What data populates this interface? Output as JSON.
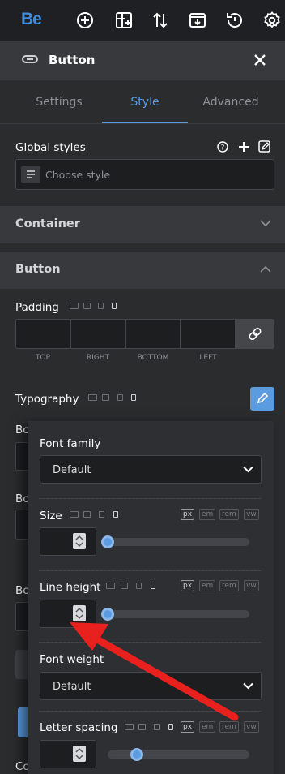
{
  "toolbar": {
    "logo": "Be",
    "icons": [
      "add-icon",
      "layout-add-icon",
      "sort-arrows-icon",
      "import-icon",
      "history-icon",
      "settings-gear-icon"
    ]
  },
  "panel": {
    "title": "Button",
    "icon": "link-icon"
  },
  "tabs": [
    {
      "label": "Settings",
      "active": false
    },
    {
      "label": "Style",
      "active": true
    },
    {
      "label": "Advanced",
      "active": false
    }
  ],
  "global_styles": {
    "label": "Global styles",
    "placeholder": "Choose style"
  },
  "sections": {
    "container": "Container",
    "button": "Button"
  },
  "padding": {
    "label": "Padding",
    "sides": [
      "TOP",
      "RIGHT",
      "BOTTOM",
      "LEFT"
    ]
  },
  "typography": {
    "label": "Typography"
  },
  "hidden_labels": {
    "b1": "Bo",
    "b2": "Bo",
    "b3": "Bo",
    "c": "Co"
  },
  "popover": {
    "font_family": {
      "label": "Font family",
      "value": "Default"
    },
    "size": {
      "label": "Size",
      "slider_level": 0,
      "units": [
        "px",
        "em",
        "rem",
        "vw"
      ],
      "active_unit": "px"
    },
    "line_height": {
      "label": "Line height",
      "slider_level": 0,
      "units": [
        "px",
        "em",
        "rem",
        "vw"
      ],
      "active_unit": "px"
    },
    "font_weight": {
      "label": "Font weight",
      "value": "Default"
    },
    "letter_spacing": {
      "label": "Letter spacing",
      "slider_level": 0.2,
      "units": [
        "px",
        "em",
        "rem",
        "vw"
      ],
      "active_unit": "px"
    }
  },
  "colors": {
    "accent": "#5b9be0",
    "annotation_arrow": "#e8211e"
  }
}
